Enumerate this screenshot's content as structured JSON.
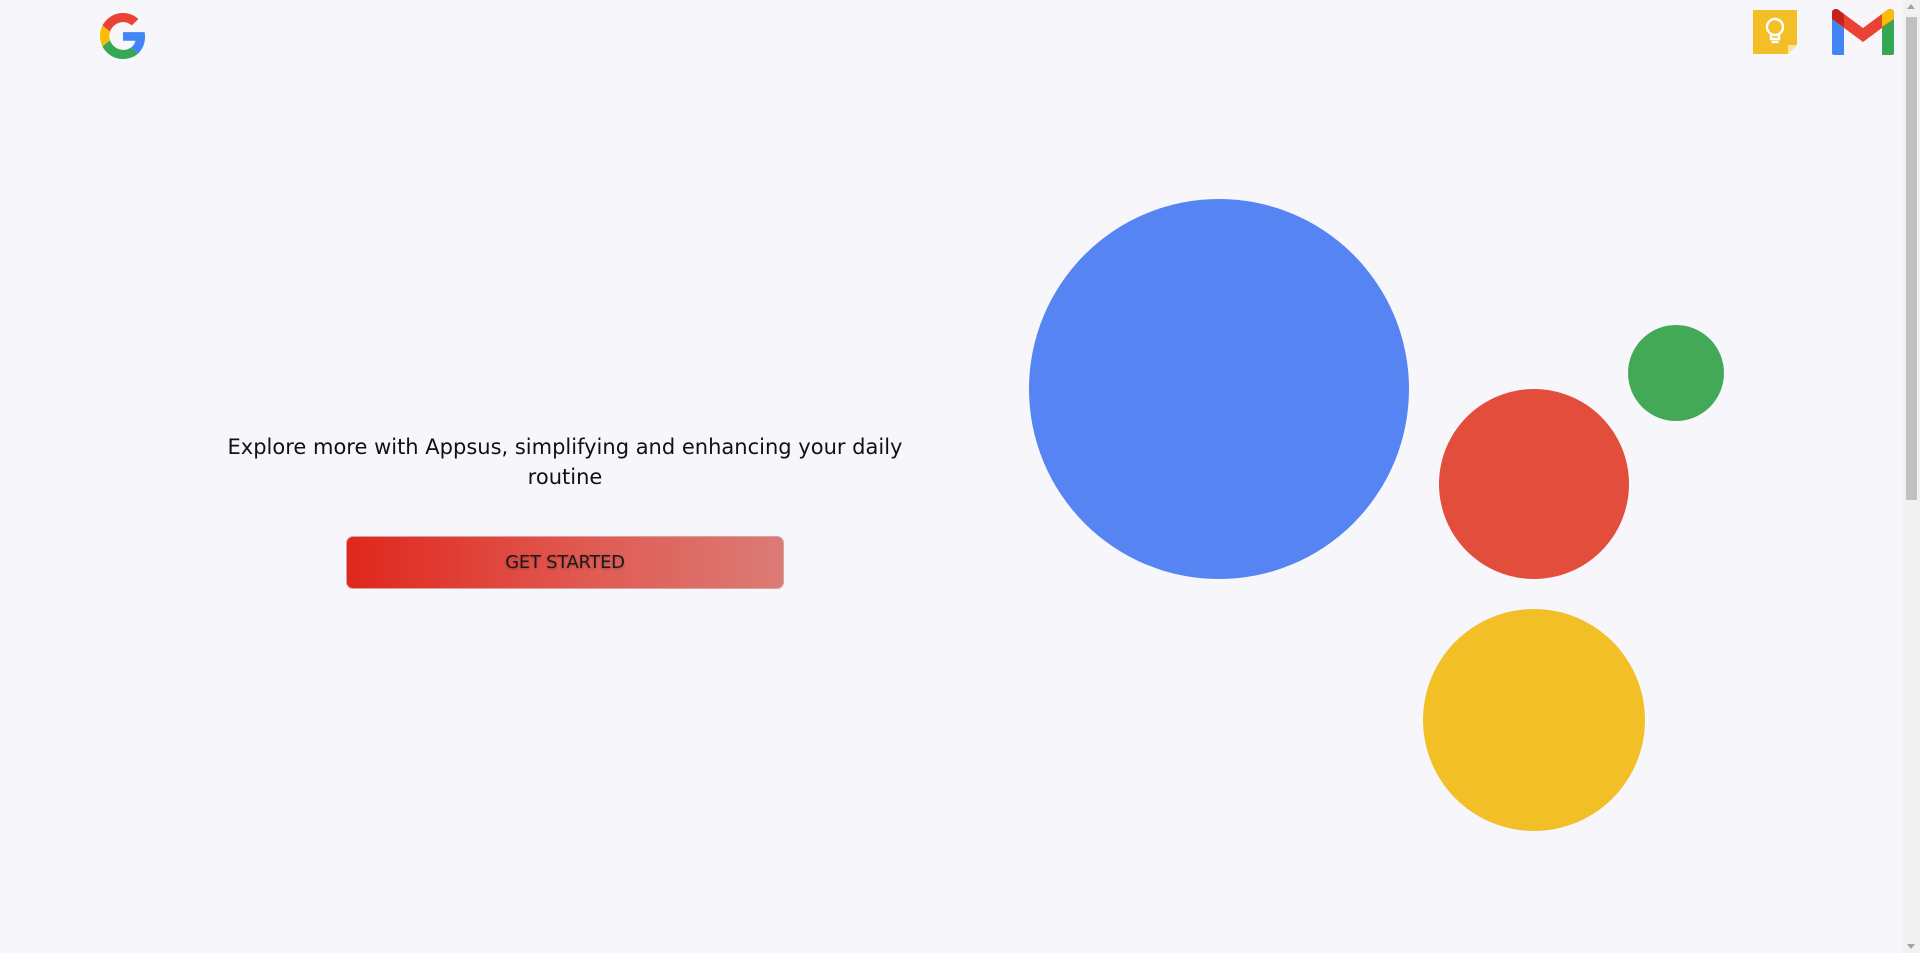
{
  "header": {
    "logo_icon": "google-g-logo",
    "apps": [
      {
        "name": "keep",
        "icon": "keep-lightbulb-icon",
        "color": "#f4bf26"
      },
      {
        "name": "gmail",
        "icon": "gmail-m-icon"
      }
    ]
  },
  "hero": {
    "tagline": "Explore more with Appsus, simplifying and enhancing your daily routine",
    "cta_label": "GET STARTED"
  },
  "decor": {
    "circles": [
      {
        "name": "blue",
        "color": "#5784f3"
      },
      {
        "name": "red",
        "color": "#e24d3c"
      },
      {
        "name": "green",
        "color": "#43a957"
      },
      {
        "name": "yellow",
        "color": "#f3bf27"
      }
    ]
  }
}
